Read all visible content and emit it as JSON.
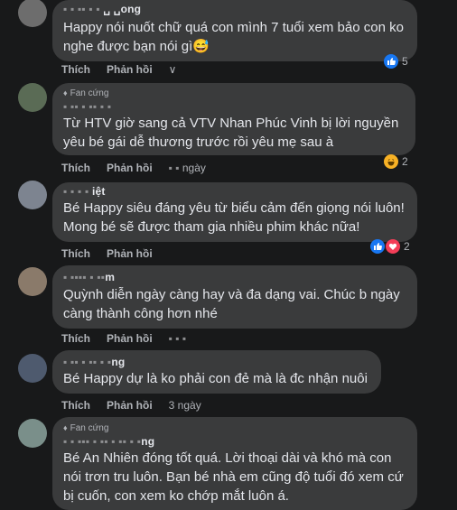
{
  "actions": {
    "like": "Thích",
    "reply": "Phản hồi"
  },
  "comments": [
    {
      "name": "␣ ␣ong",
      "badge": "",
      "text": "Happy nói nuốt chữ quá con mình 7 tuổi xem bảo con ko nghe được bạn nói gì😅",
      "time": "∨",
      "reaction_count": "5",
      "reactions": [
        "like"
      ],
      "avatar_color": "#6d6d6d"
    },
    {
      "name": "",
      "badge": "Fan cứng",
      "text": "Từ HTV giờ sang cả VTV Nhan Phúc Vinh bị lời nguyền yêu bé gái dễ thương trước rồi yêu mẹ sau à",
      "time": "ngày",
      "reaction_count": "2",
      "reactions": [
        "haha"
      ],
      "avatar_color": "#5a6b55"
    },
    {
      "name": "iệt",
      "badge": "",
      "text": "Bé Happy siêu đáng yêu từ biểu cảm đến giọng nói luôn! Mong bé sẽ được tham gia nhiều phim khác nữa!",
      "time": "",
      "reaction_count": "2",
      "reactions": [
        "like",
        "love"
      ],
      "avatar_color": "#7d8490"
    },
    {
      "name": "m",
      "badge": "",
      "text": "Quỳnh diễn ngày càng hay và đa dạng vai. Chúc b ngày càng thành công hơn nhé",
      "time": "",
      "reaction_count": "",
      "reactions": [],
      "avatar_color": "#8a7a6a"
    },
    {
      "name": "ng",
      "badge": "",
      "text": "Bé Happy dự là ko phải con đẻ mà là đc nhận nuôi",
      "time": "3 ngày",
      "reaction_count": "",
      "reactions": [],
      "avatar_color": "#4e5a6e"
    },
    {
      "name": "ng",
      "badge": "Fan cứng",
      "text": "Bé An Nhiên đóng tốt quá. Lời thoại dài và khó mà con nói trơn tru luôn. Bạn bé nhà em cũng độ tuổi đó xem cứ bị cuốn, con xem ko chớp mắt luôn á.",
      "time": "",
      "reaction_count": "",
      "reactions": [],
      "avatar_color": "#7a8f8a"
    }
  ]
}
